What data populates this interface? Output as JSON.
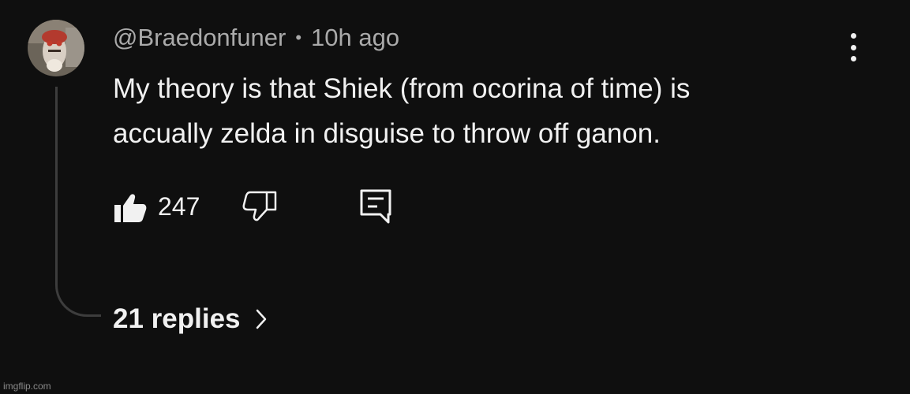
{
  "comment": {
    "author": "@Braedonfuner",
    "separator": "•",
    "timestamp": "10h ago",
    "text_lines": [
      "My theory is that Shiek (from ocorina of time) is",
      "accually zelda in disguise to throw off ganon."
    ],
    "like_count": "247",
    "replies_label": "21 replies"
  },
  "icons": {
    "like": "thumbs-up-icon",
    "dislike": "thumbs-down-icon",
    "reply": "comment-icon",
    "menu": "more-vertical-icon",
    "expand": "chevron-right-icon"
  },
  "colors": {
    "background": "#0f0f0f",
    "text": "#f1f1f1",
    "secondary_text": "#aaaaaa",
    "thread_line": "#3d3d3d"
  },
  "watermark": "imgflip.com"
}
